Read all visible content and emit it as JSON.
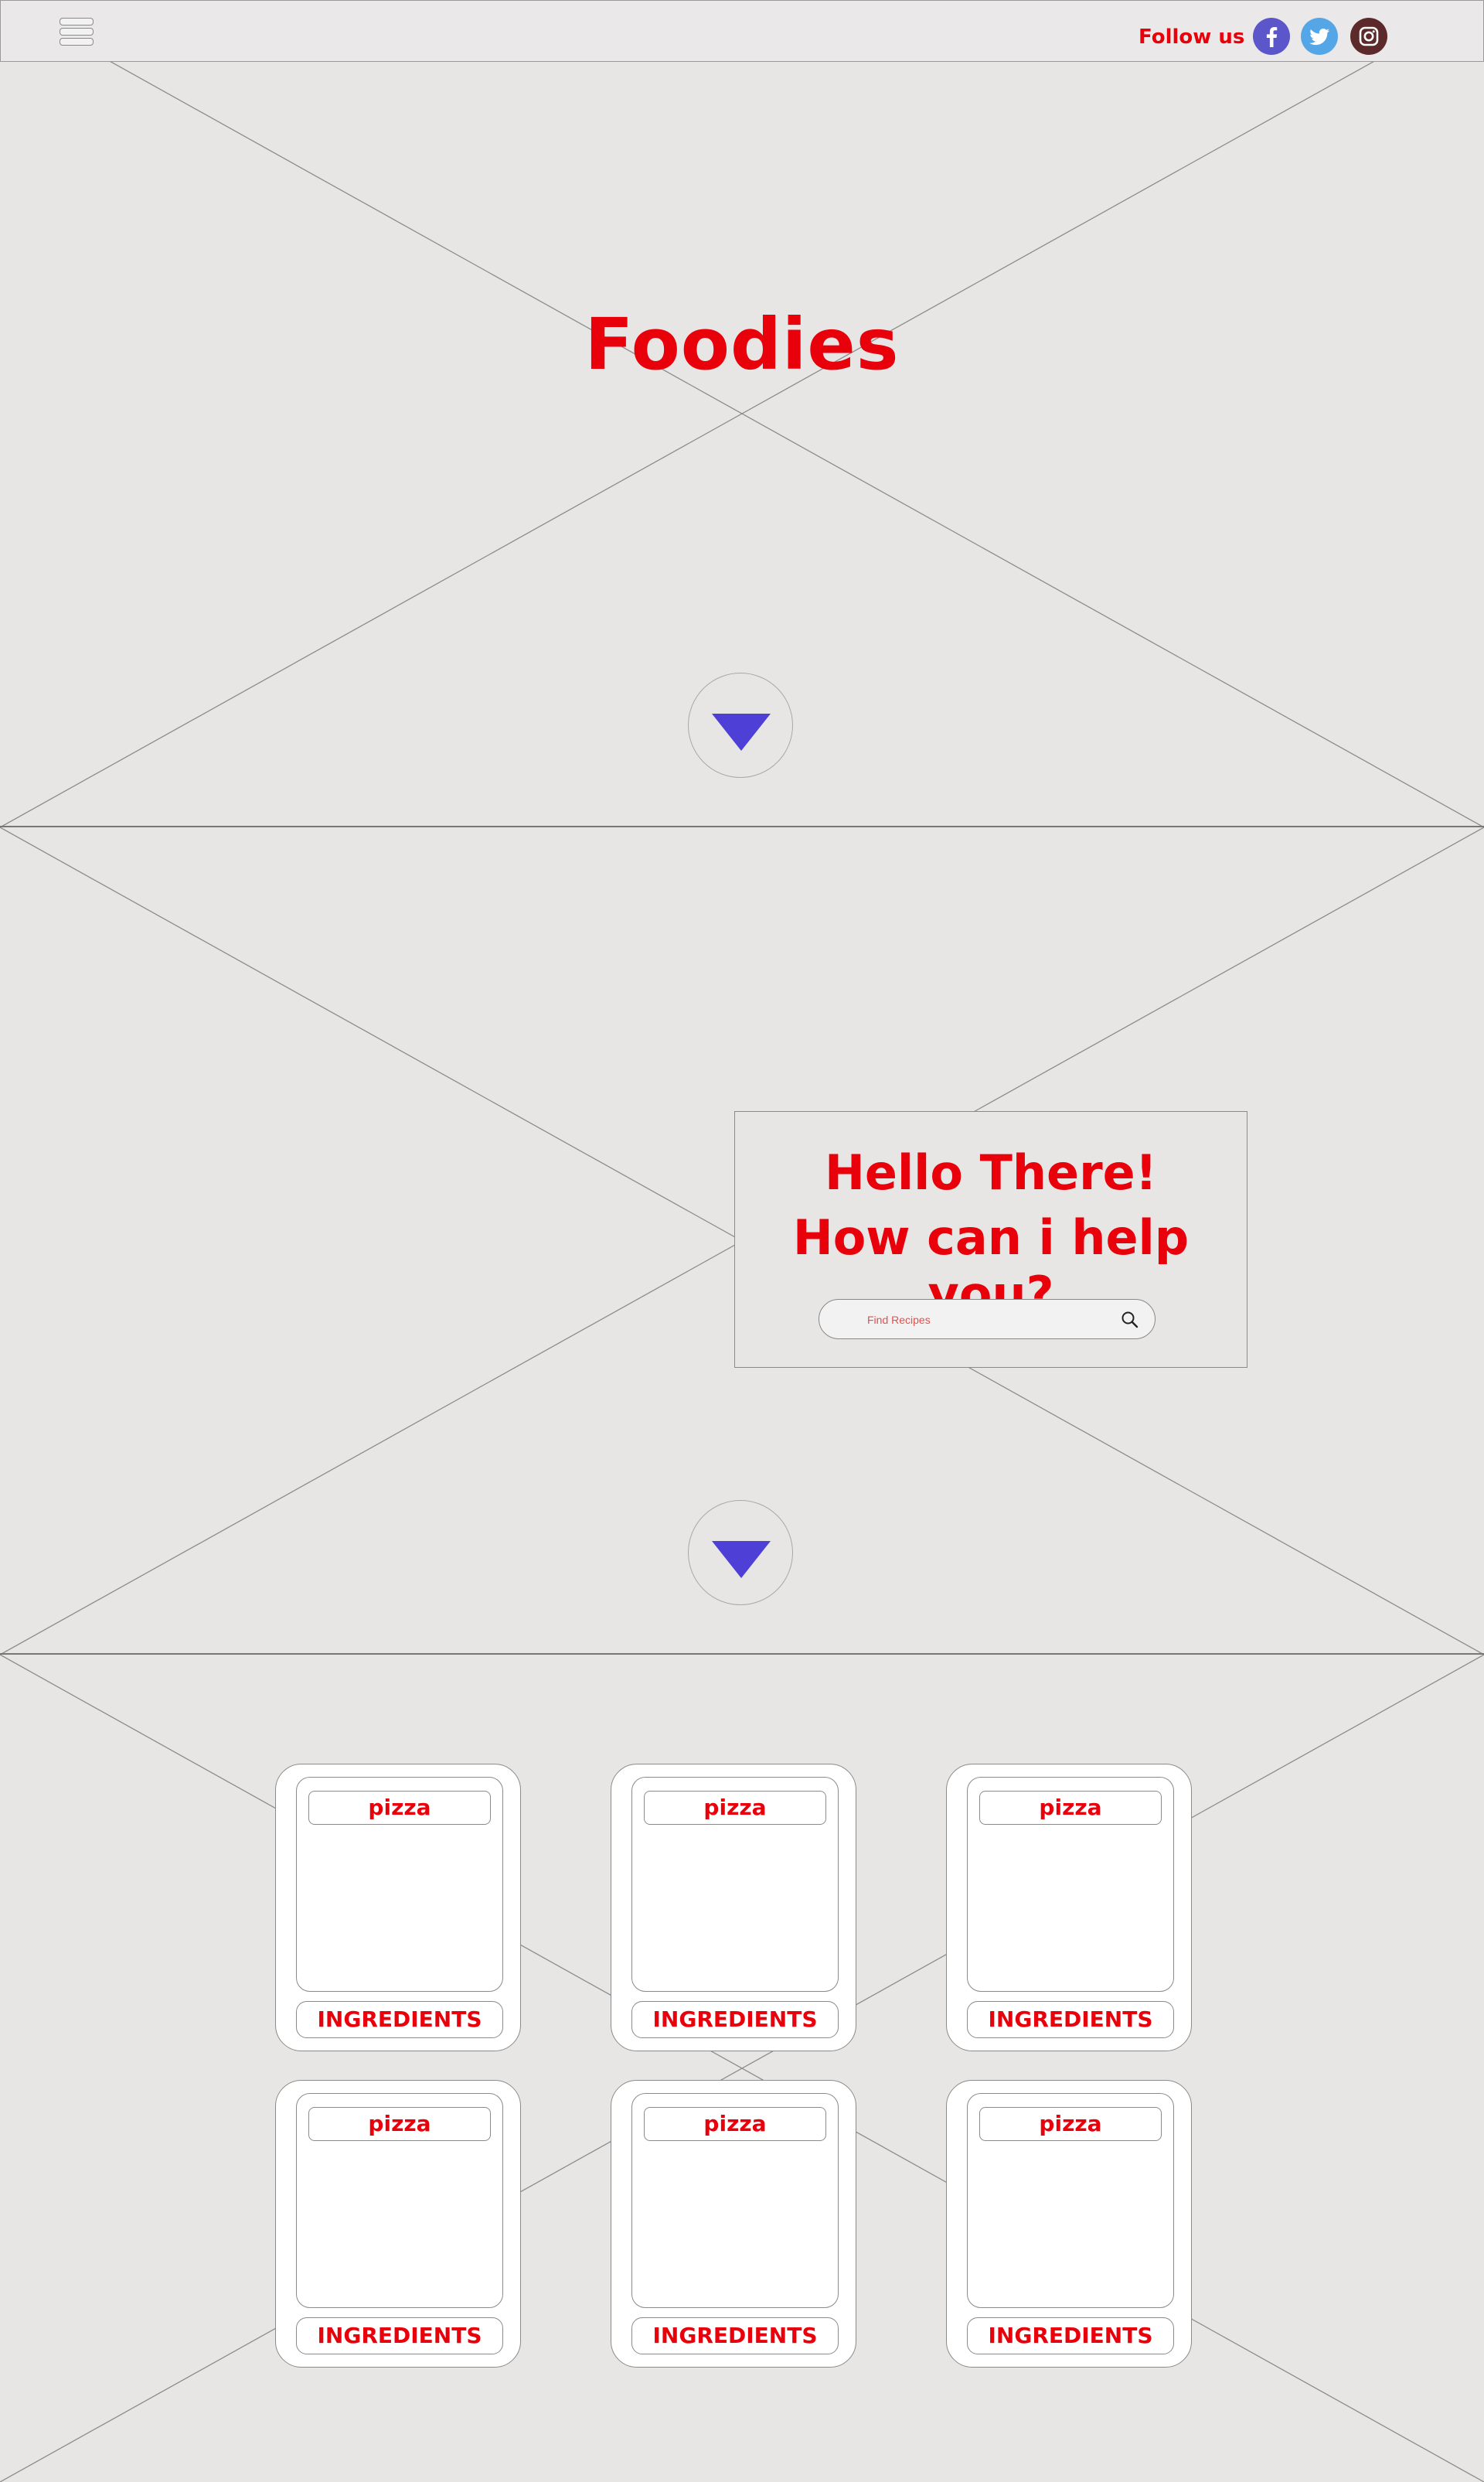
{
  "header": {
    "follow_label": "Follow us",
    "socials": [
      {
        "icon": "facebook-icon",
        "color": "#5b56c9"
      },
      {
        "icon": "twitter-icon",
        "color": "#55a6e6"
      },
      {
        "icon": "instagram-icon",
        "color": "#5c2a2a"
      }
    ]
  },
  "hero": {
    "title": "Foodies"
  },
  "greeting": {
    "line1": "Hello There!",
    "line2": "How can i help you?",
    "search_placeholder": "Find Recipes"
  },
  "recipes": [
    {
      "name": "pizza",
      "action": "INGREDIENTS"
    },
    {
      "name": "pizza",
      "action": "INGREDIENTS"
    },
    {
      "name": "pizza",
      "action": "INGREDIENTS"
    },
    {
      "name": "pizza",
      "action": "INGREDIENTS"
    },
    {
      "name": "pizza",
      "action": "INGREDIENTS"
    },
    {
      "name": "pizza",
      "action": "INGREDIENTS"
    }
  ],
  "colors": {
    "accent": "#e8000b",
    "arrow": "#4e3fd6",
    "background": "#e8e6e5"
  }
}
